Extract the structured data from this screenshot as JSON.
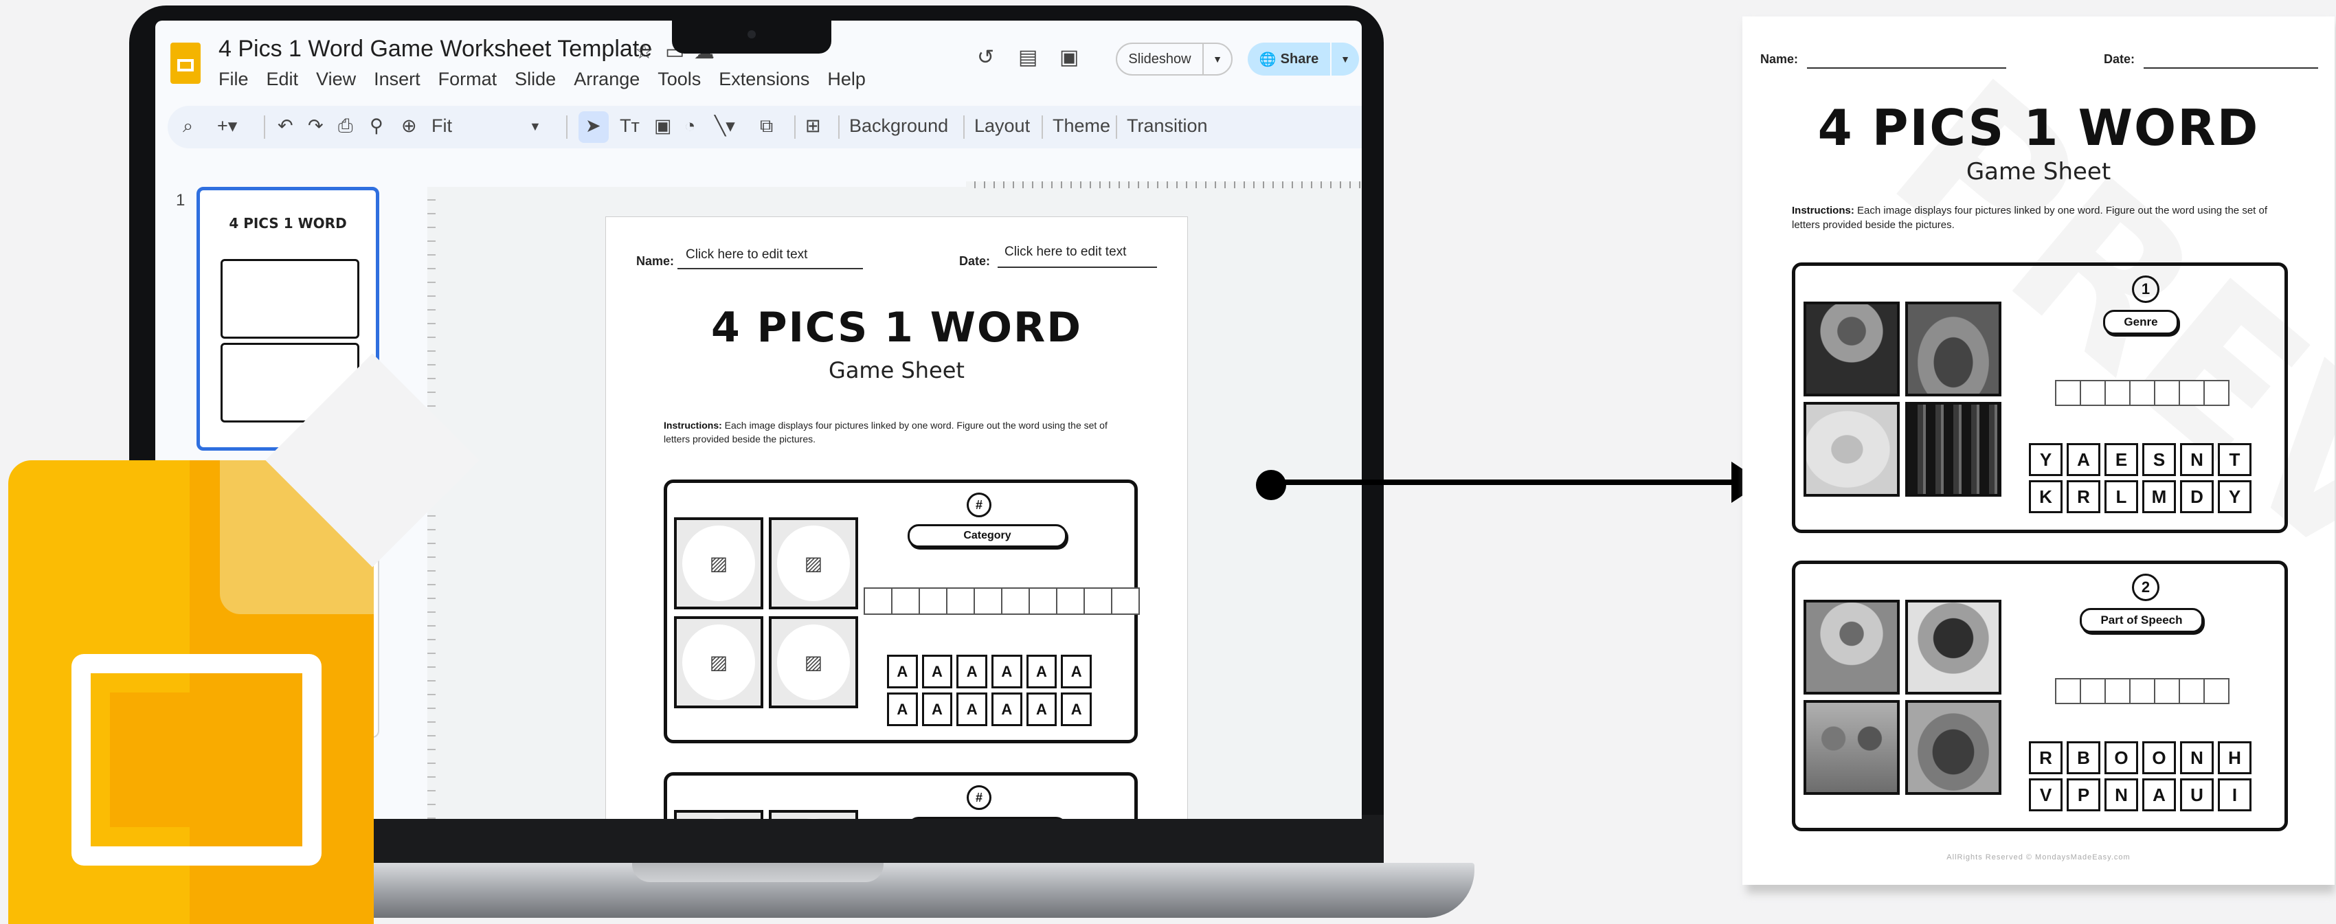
{
  "app": {
    "doc_title": "4 Pics 1 Word Game Worksheet Template",
    "menu": [
      "File",
      "Edit",
      "View",
      "Insert",
      "Format",
      "Slide",
      "Arrange",
      "Tools",
      "Extensions",
      "Help"
    ],
    "slideshow_label": "Slideshow",
    "share_label": "Share",
    "toolbar": {
      "zoom_label": "Fit",
      "background_label": "Background",
      "layout_label": "Layout",
      "theme_label": "Theme",
      "transition_label": "Transition"
    },
    "slide_number": "1"
  },
  "slide": {
    "name_label": "Name:",
    "name_placeholder": "Click here to edit text",
    "date_label": "Date:",
    "date_placeholder": "Click here to edit text",
    "title": "4 PICS 1 WORD",
    "subtitle": "Game Sheet",
    "instructions_label": "Instructions:",
    "instructions_text": " Each image displays four pictures linked by one word. Figure out the word using the set of letters provided beside the pictures.",
    "puzzle_number": "#",
    "category_label": "Category",
    "tile_letter": "A"
  },
  "preview": {
    "name_label": "Name:",
    "date_label": "Date:",
    "title": "4 PICS 1 WORD",
    "subtitle": "Game Sheet",
    "instructions_label": "Instructions:",
    "instructions_text": " Each image displays four pictures linked by one word. Figure out the word using the set of letters provided beside the pictures.",
    "watermark": "PREVIEW",
    "footer": "AllRights Reserved © MondaysMadeEasy.com",
    "puzzles": [
      {
        "number": "1",
        "category": "Genre",
        "letters": [
          "Y",
          "A",
          "E",
          "S",
          "N",
          "T",
          "K",
          "R",
          "L",
          "M",
          "D",
          "Y"
        ]
      },
      {
        "number": "2",
        "category": "Part of Speech",
        "letters": [
          "R",
          "B",
          "O",
          "O",
          "N",
          "H",
          "V",
          "P",
          "N",
          "A",
          "U",
          "I"
        ]
      }
    ]
  }
}
